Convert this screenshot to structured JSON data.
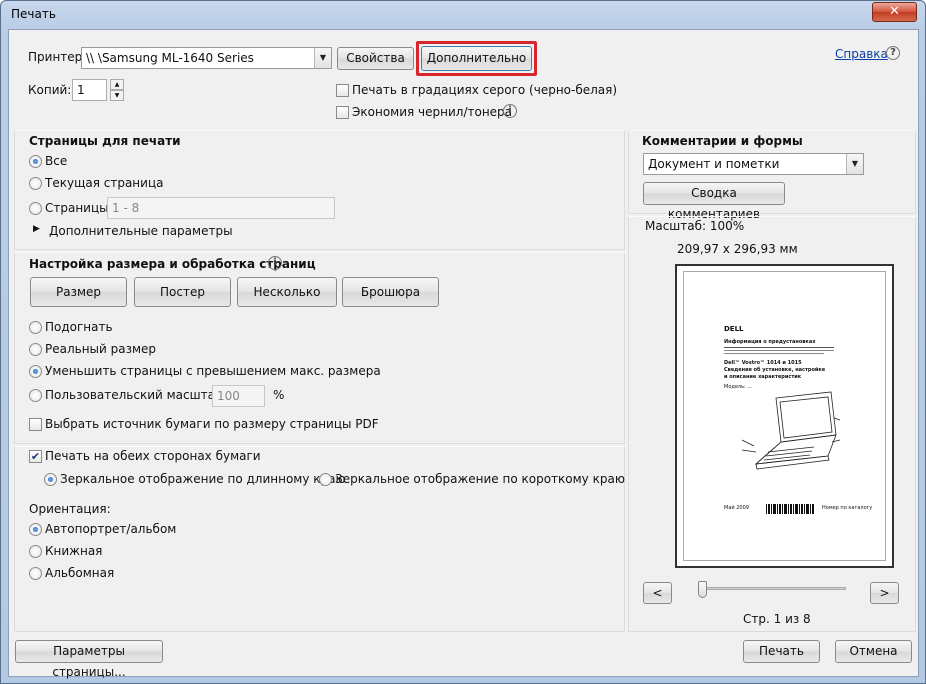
{
  "window": {
    "title": "Печать",
    "close_glyph": "✕"
  },
  "printer": {
    "label": "Принтер:",
    "value": "\\\\        \\Samsung ML-1640 Series",
    "properties_button": "Свойства",
    "advanced_button": "Дополнительно",
    "help_link": "Справка",
    "copies_label": "Копий:",
    "copies_value": "1",
    "grayscale_label": "Печать в градациях серого (черно-белая)",
    "grayscale_checked": false,
    "save_ink_label": "Экономия чернил/тонера",
    "save_ink_checked": false
  },
  "pages": {
    "heading": "Страницы для печати",
    "all_label": "Все",
    "current_label": "Текущая страница",
    "range_label": "Страницы",
    "range_value": "1 - 8",
    "more_options_label": "Дополнительные параметры",
    "selected": "all"
  },
  "sizing": {
    "heading": "Настройка размера и обработка страниц",
    "tabs": [
      "Размер",
      "Постер",
      "Несколько",
      "Брошюра"
    ],
    "fit_label": "Подогнать",
    "actual_label": "Реальный размер",
    "shrink_label": "Уменьшить страницы с превышением макс. размера",
    "custom_label": "Пользовательский масштаб:",
    "custom_value": "100",
    "percent": "%",
    "selected": "shrink",
    "paper_source_label": "Выбрать источник бумаги по размеру страницы PDF",
    "paper_source_checked": false
  },
  "duplex": {
    "both_sides_label": "Печать на обеих сторонах бумаги",
    "both_sides_checked": true,
    "long_edge_label": "Зеркальное отображение по длинному краю",
    "short_edge_label": "Зеркальное отображение по короткому краю",
    "selected": "long"
  },
  "orientation": {
    "heading": "Ориентация:",
    "auto_label": "Автопортрет/альбом",
    "portrait_label": "Книжная",
    "landscape_label": "Альбомная",
    "selected": "auto"
  },
  "comments": {
    "heading": "Комментарии и формы",
    "value": "Документ и пометки",
    "summary_button": "Сводка комментариев"
  },
  "preview": {
    "scale": "Масштаб: 100%",
    "size": "209,97 x 296,93 мм",
    "page_status": "Стр. 1 из 8",
    "prev_button": "<",
    "next_button": ">",
    "slider_fraction": 0.0,
    "doc": {
      "logo": "DELL",
      "heading": "Информация о предустановках",
      "line1": "Dell™ Vostro™ 1014 и 1015",
      "line2": "Сведения об установке, настройке",
      "line3": "и описание характеристик",
      "line4": "Модель: ...",
      "footer_left": "Май 2009",
      "footer_right": "Номер по каталогу"
    }
  },
  "footer": {
    "page_setup_button": "Параметры страницы...",
    "print_button": "Печать",
    "cancel_button": "Отмена"
  },
  "colors": {
    "highlight": "#d8262c",
    "link": "#0a3ea8",
    "title_bg": "#c7d7ec"
  }
}
